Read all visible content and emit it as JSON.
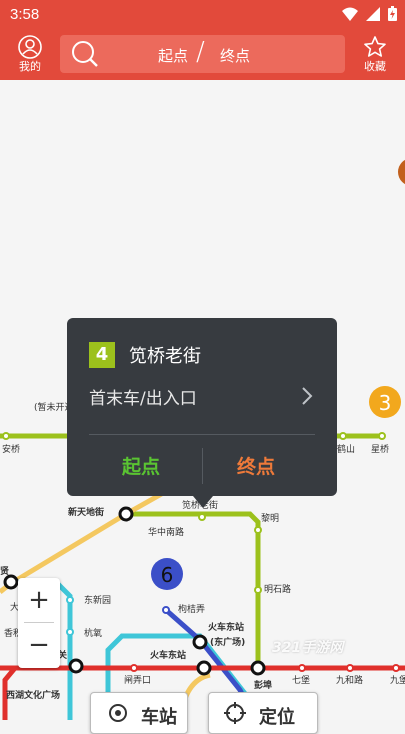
{
  "status_bar": {
    "time": "3:58"
  },
  "topbar": {
    "profile_label": "我的",
    "favorites_label": "收藏",
    "search": {
      "start": "起点",
      "separator": "/",
      "end": "终点"
    }
  },
  "popup": {
    "line_number": "4",
    "station_name": "笕桥老街",
    "info_label": "首末车/出入口",
    "start_button": "起点",
    "end_button": "终点"
  },
  "map": {
    "line_badges": {
      "line3": "3",
      "line6": "6"
    },
    "stations": {
      "anqiao": "安桥",
      "heshan": "鹤山",
      "xingqiao": "星桥",
      "xintiandijie": "新天地街",
      "huazhongnanlu": "华中南路",
      "jianqiaolaojie": "笕桥老街",
      "liming": "黎明",
      "mingshilu": "明石路",
      "dongxinyuan": "东新园",
      "hangyang": "杭氧",
      "goujinong": "枸桔弄",
      "huochedongzhan_east_plaza": "火车东站",
      "east_plaza_sub": "(东广场)",
      "huochedongzhan": "火车东站",
      "zhanlongkou": "闸弄口",
      "pengbu": "彭埠",
      "qibao": "七堡",
      "jiuhelu": "九和路",
      "jiubao": "九堡",
      "xihuwenhuaguangchang": "西湖文化广场",
      "guan": "关",
      "xian": "贤",
      "xiangji": "香积",
      "da": "大",
      "construction_note": "(暂未开通)"
    }
  },
  "zoom": {
    "plus": "+",
    "minus": "−"
  },
  "bottom": {
    "station_button": "车站",
    "locate_button": "定位"
  },
  "watermark": "321手游网",
  "colors": {
    "brand": "#e24a3b",
    "line4": "#9cc11c",
    "line1": "#e0302c",
    "line5": "#3fc6d8",
    "line6": "#3b4fc8",
    "line3": "#f2a81d",
    "popup_bg": "#373b40",
    "start_green": "#5ac432",
    "end_orange": "#ee7a3a"
  }
}
